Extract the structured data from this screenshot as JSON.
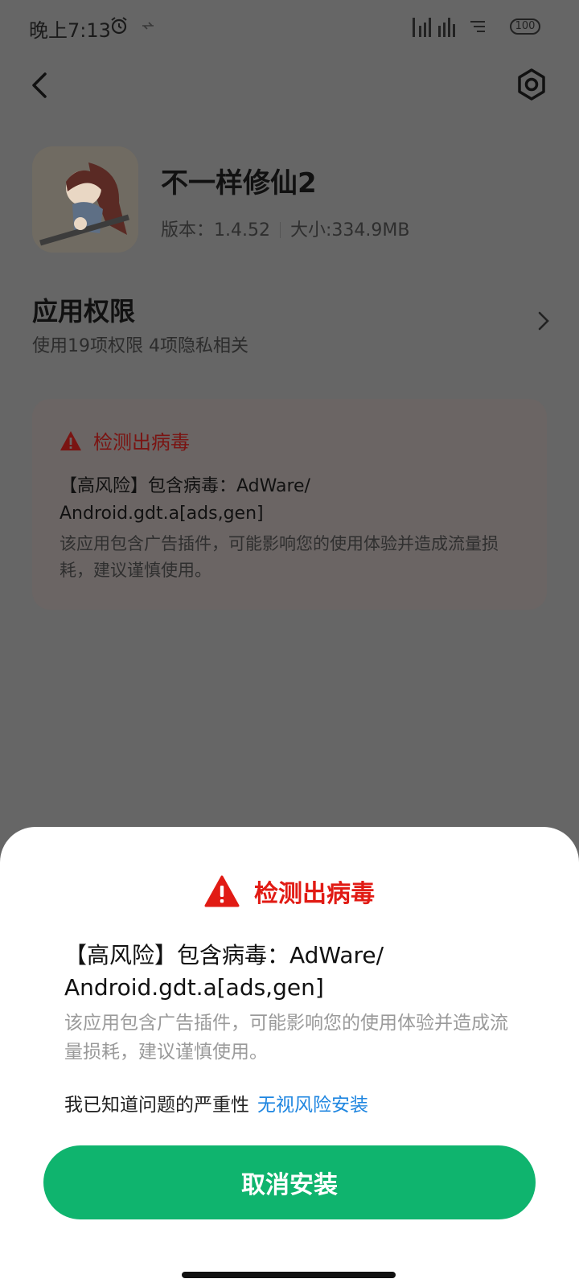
{
  "status_bar": {
    "time": "晚上7:13",
    "icons": [
      "alarm-icon",
      "sync-icon",
      "signal-icon",
      "wifi-icon",
      "battery-icon"
    ],
    "battery": "100"
  },
  "header": {
    "back_icon": "back-arrow-icon",
    "settings_icon": "gear-icon"
  },
  "app": {
    "name": "不一样修仙2",
    "version": "版本：1.4.52",
    "size": "大小:334.9MB"
  },
  "permissions": {
    "title": "应用权限",
    "subtitle": "使用19项权限 4项隐私相关"
  },
  "virus_card": {
    "title": "检测出病毒",
    "risk": "【高风险】包含病毒：AdWare/ Android.gdt.a[ads,gen]",
    "description": "该应用包含广告插件，可能影响您的使用体验并造成流量损耗，建议谨慎使用。"
  },
  "sheet": {
    "title": "检测出病毒",
    "risk": "【高风险】包含病毒：AdWare/ Android.gdt.a[ads,gen]",
    "description": "该应用包含广告插件，可能影响您的使用体验并造成流量损耗，建议谨慎使用。",
    "ack_text": "我已知道问题的严重性",
    "ignore_link": "无视风险安装",
    "cancel_button": "取消安装"
  },
  "colors": {
    "dim_overlay": "#666666",
    "warning_red": "#e11b14",
    "link_blue": "#1f86e0",
    "primary_green": "#0fb46e"
  }
}
